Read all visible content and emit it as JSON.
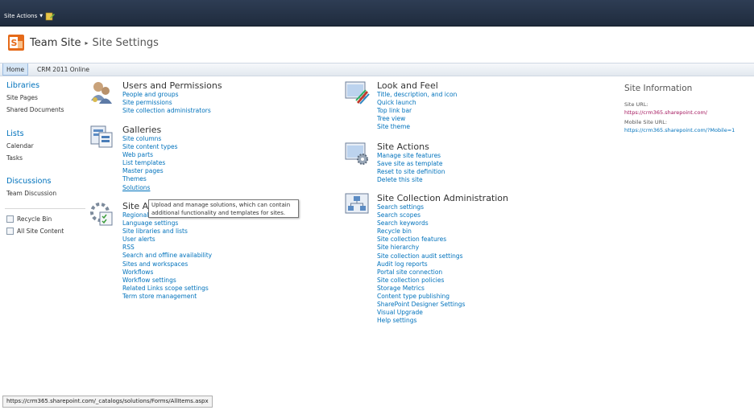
{
  "ribbon": {
    "site_actions_label": "Site Actions",
    "edit_icon": "edit-page-icon"
  },
  "breadcrumb": {
    "site": "Team Site",
    "separator": "▸",
    "page": "Site Settings"
  },
  "topnav": {
    "items": [
      "Home",
      "CRM 2011 Online"
    ]
  },
  "quicklaunch": {
    "libraries": {
      "heading": "Libraries",
      "items": [
        "Site Pages",
        "Shared Documents"
      ]
    },
    "lists": {
      "heading": "Lists",
      "items": [
        "Calendar",
        "Tasks"
      ]
    },
    "discussions": {
      "heading": "Discussions",
      "items": [
        "Team Discussion"
      ]
    },
    "utilities": [
      "Recycle Bin",
      "All Site Content"
    ]
  },
  "sections": {
    "users": {
      "title": "Users and Permissions",
      "links": [
        "People and groups",
        "Site permissions",
        "Site collection administrators"
      ]
    },
    "galleries": {
      "title": "Galleries",
      "links": [
        "Site columns",
        "Site content types",
        "Web parts",
        "List templates",
        "Master pages",
        "Themes",
        "Solutions"
      ]
    },
    "siteadmin": {
      "title": "Site Ac",
      "links": [
        "Regional",
        "Language settings",
        "Site libraries and lists",
        "User alerts",
        "RSS",
        "Search and offline availability",
        "Sites and workspaces",
        "Workflows",
        "Workflow settings",
        "Related Links scope settings",
        "Term store management"
      ]
    },
    "lookfeel": {
      "title": "Look and Feel",
      "links": [
        "Title, description, and icon",
        "Quick launch",
        "Top link bar",
        "Tree view",
        "Site theme"
      ]
    },
    "siteactions": {
      "title": "Site Actions",
      "links": [
        "Manage site features",
        "Save site as template",
        "Reset to site definition",
        "Delete this site"
      ]
    },
    "sitecollection": {
      "title": "Site Collection Administration",
      "links": [
        "Search settings",
        "Search scopes",
        "Search keywords",
        "Recycle bin",
        "Site collection features",
        "Site hierarchy",
        "Site collection audit settings",
        "Audit log reports",
        "Portal site connection",
        "Site collection policies",
        "Storage Metrics",
        "Content type publishing",
        "SharePoint Designer Settings",
        "Visual Upgrade",
        "Help settings"
      ]
    }
  },
  "tooltip": {
    "line1": "Upload and manage solutions, which can contain",
    "line2": "additional functionality and templates for sites."
  },
  "site_info": {
    "title": "Site Information",
    "url_label": "Site URL:",
    "url": "https://crm365.sharepoint.com/",
    "mobile_label": "Mobile Site URL:",
    "mobile_url": "https://crm365.sharepoint.com/?Mobile=1"
  },
  "status_bar": "https://crm365.sharepoint.com/_catalogs/solutions/Forms/AllItems.aspx",
  "colors": {
    "ribbon": "#253349",
    "link": "#0072bc",
    "heading": "#0072bc",
    "url": "#a3145c"
  }
}
